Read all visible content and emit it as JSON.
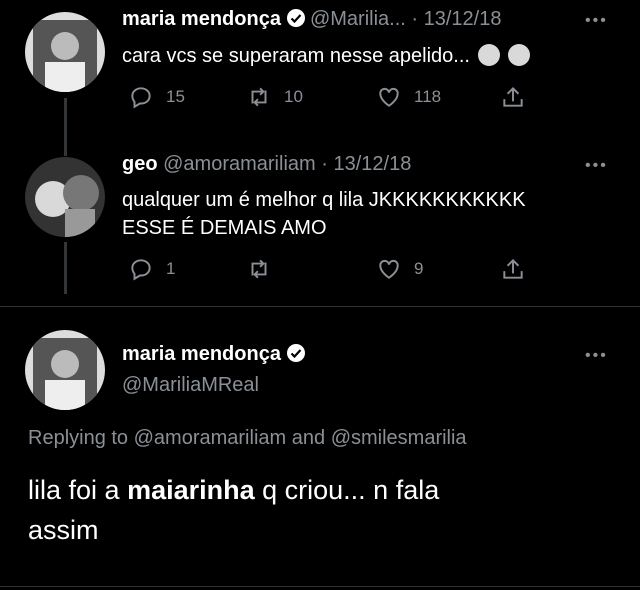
{
  "tweets": [
    {
      "name": "maria mendonça",
      "handle": "@Marilia...",
      "date": "· 13/12/18",
      "text": "cara vcs se superaram nesse apelido...",
      "emojis": [
        "woman-emoji",
        "tears-of-joy-emoji"
      ],
      "replies": "15",
      "retweets": "10",
      "likes": "118"
    },
    {
      "name": "geo",
      "handle": "@amoramariliam",
      "date": "· 13/12/18",
      "text_line1": "qualquer um é melhor q lila JKKKKKKKKKKK",
      "text_line2": "ESSE É DEMAIS AMO",
      "replies": "1",
      "retweets": "",
      "likes": "9"
    }
  ],
  "main": {
    "name": "maria mendonça",
    "handle": "@MariliaMReal",
    "replying_prefix": "Replying to",
    "replying_user1": "@amoramariliam",
    "replying_and": "and",
    "replying_user2": "@smilesmarilia",
    "text_part1": "lila foi a ",
    "text_bold": "maiarinha",
    "text_part2": " q criou... n fala",
    "text_line2": "assim"
  },
  "more_glyph": "•••",
  "colors": {
    "background": "#000000",
    "muted": "#8b9096",
    "text": "#ffffff"
  }
}
